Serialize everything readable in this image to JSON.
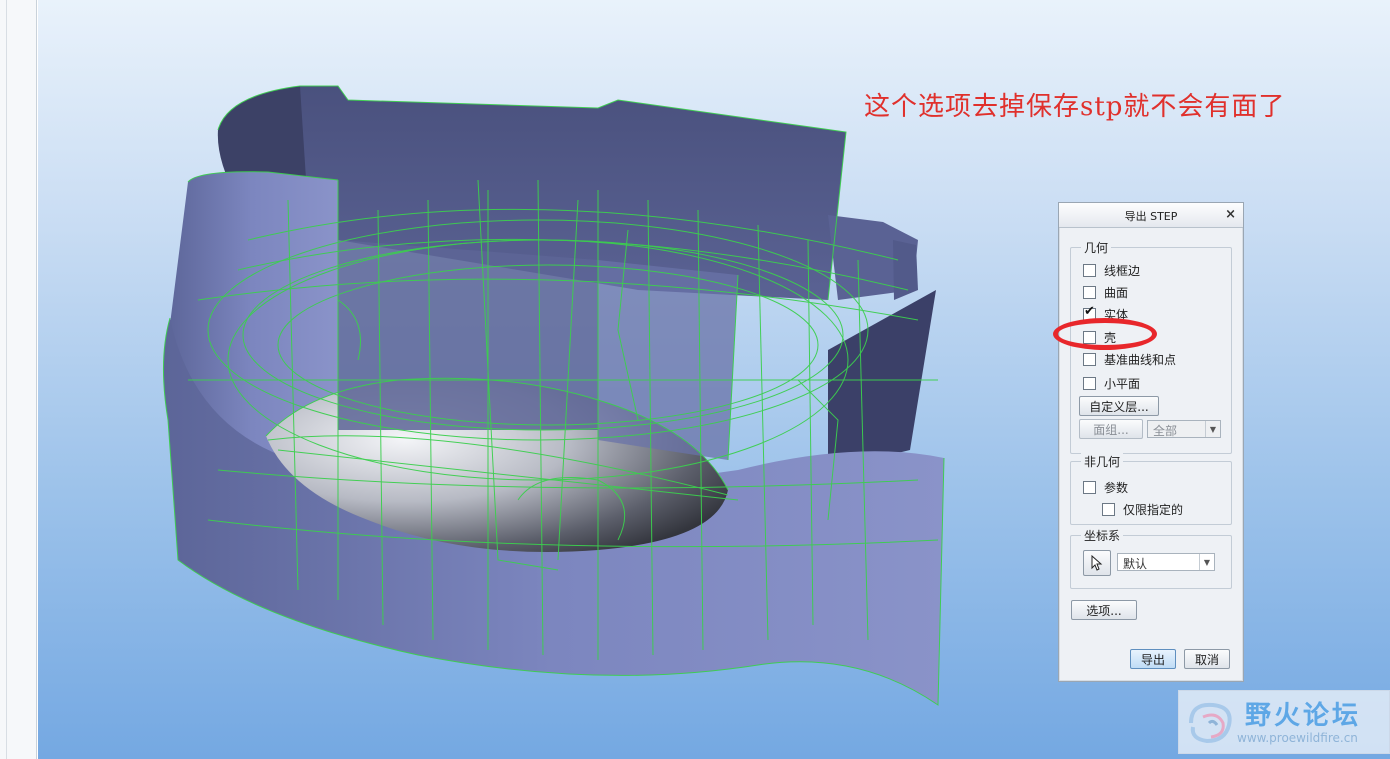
{
  "annotation_text": "这个选项去掉保存stp就不会有面了",
  "dialog": {
    "title": "导出 STEP",
    "close_glyph": "×",
    "geometry_group": {
      "label": "几何",
      "options": [
        {
          "label": "线框边",
          "checked": false
        },
        {
          "label": "曲面",
          "checked": false
        },
        {
          "label": "实体",
          "checked": true
        },
        {
          "label": "壳",
          "checked": false
        },
        {
          "label": "基准曲线和点",
          "checked": false
        },
        {
          "label": "小平面",
          "checked": false
        }
      ],
      "custom_layer_button": "自定义层...",
      "quilt_button": "面组...",
      "quilt_select_value": "全部"
    },
    "nongeometry_group": {
      "label": "非几何",
      "parameters_label": "参数",
      "only_designated_label": "仅限指定的"
    },
    "csys_group": {
      "label": "坐标系",
      "select_value": "默认"
    },
    "options_button": "选项...",
    "export_button": "导出",
    "cancel_button": "取消"
  },
  "watermark": {
    "title": "野火论坛",
    "url": "www.proewildfire.cn"
  },
  "colors": {
    "annotation": "#e0302c",
    "highlight_ellipse": "#e8272b",
    "surface_fill": "#6e77ad",
    "wireframe": "#3ccf4e"
  }
}
